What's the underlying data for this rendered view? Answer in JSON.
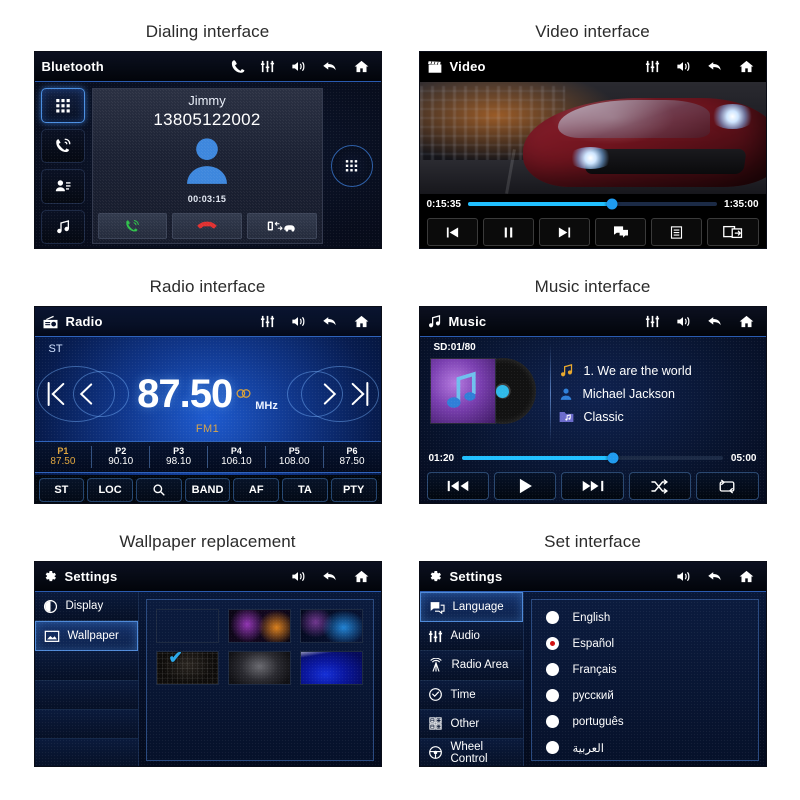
{
  "panels": [
    {
      "caption": "Dialing interface",
      "title": "Bluetooth",
      "statusIcons": [
        "phone-icon",
        "equalizer-icon",
        "volume-icon",
        "back-icon",
        "home-icon"
      ],
      "rail": [
        "keypad-icon",
        "call-log-icon",
        "contacts-icon",
        "music-icon"
      ],
      "contact_name": "Jimmy",
      "phone_number": "13805122002",
      "call_timer": "00:03:15",
      "actions": [
        "answer-call-icon",
        "end-call-icon",
        "transfer-audio-icon"
      ],
      "keypad_button": "dialpad-icon"
    },
    {
      "caption": "Video interface",
      "title": "Video",
      "titleIcon": "clapperboard-icon",
      "statusIcons": [
        "equalizer-icon",
        "volume-icon",
        "back-icon",
        "home-icon"
      ],
      "elapsed": "0:15:35",
      "duration": "1:35:00",
      "progress_percent": 58,
      "controls": [
        "previous-icon",
        "pause-icon",
        "next-icon",
        "subtitle-icon",
        "playlist-icon",
        "screen-share-icon"
      ]
    },
    {
      "caption": "Radio interface",
      "title": "Radio",
      "titleIcon": "radio-icon",
      "statusIcons": [
        "equalizer-icon",
        "volume-icon",
        "back-icon",
        "home-icon"
      ],
      "stereo_indicator": "ST",
      "frequency": "87.50",
      "unit": "MHz",
      "band": "FM1",
      "presets": [
        {
          "name": "P1",
          "freq": "87.50",
          "active": true
        },
        {
          "name": "P2",
          "freq": "90.10",
          "active": false
        },
        {
          "name": "P3",
          "freq": "98.10",
          "active": false
        },
        {
          "name": "P4",
          "freq": "106.10",
          "active": false
        },
        {
          "name": "P5",
          "freq": "108.00",
          "active": false
        },
        {
          "name": "P6",
          "freq": "87.50",
          "active": false
        }
      ],
      "tabs": [
        "ST",
        "LOC",
        "search-icon",
        "BAND",
        "AF",
        "TA",
        "PTY"
      ]
    },
    {
      "caption": "Music interface",
      "title": "Music",
      "titleIcon": "music-note-icon",
      "statusIcons": [
        "equalizer-icon",
        "volume-icon",
        "back-icon",
        "home-icon"
      ],
      "source_label": "SD:01/80",
      "track": "1.  We are the world",
      "artist": "Michael Jackson",
      "genre": "Classic",
      "elapsed": "01:20",
      "duration": "05:00",
      "progress_percent": 58,
      "controls": [
        "previous-track-icon",
        "play-icon",
        "next-track-icon",
        "shuffle-icon",
        "repeat-icon"
      ]
    },
    {
      "caption": "Wallpaper replacement",
      "title": "Settings",
      "titleIcon": "gear-icon",
      "statusIcons": [
        "volume-icon",
        "back-icon",
        "home-icon"
      ],
      "menu": [
        {
          "label": "Display",
          "icon": "contrast-icon",
          "active": false
        },
        {
          "label": "Wallpaper",
          "icon": "image-icon",
          "active": true
        },
        {
          "label": "",
          "icon": "",
          "active": false
        },
        {
          "label": "",
          "icon": "",
          "active": false
        },
        {
          "label": "",
          "icon": "",
          "active": false
        },
        {
          "label": "",
          "icon": "",
          "active": false
        }
      ],
      "wallpapers": [
        {
          "id": "wp-blue-glow",
          "selected": true
        },
        {
          "id": "wp-neon-waves",
          "selected": false
        },
        {
          "id": "wp-cyan-bloom",
          "selected": false
        },
        {
          "id": "wp-dark-mesh",
          "selected": false
        },
        {
          "id": "wp-grey-fog",
          "selected": false
        },
        {
          "id": "wp-blue-streak",
          "selected": false
        }
      ],
      "check_mark": "✔"
    },
    {
      "caption": "Set interface",
      "title": "Settings",
      "titleIcon": "gear-icon",
      "statusIcons": [
        "volume-icon",
        "back-icon",
        "home-icon"
      ],
      "menu": [
        {
          "label": "Language",
          "icon": "speech-bubble-icon",
          "active": true
        },
        {
          "label": "Audio",
          "icon": "equalizer-icon",
          "active": false
        },
        {
          "label": "Radio Area",
          "icon": "antenna-icon",
          "active": false
        },
        {
          "label": "Time",
          "icon": "clock-icon",
          "active": false
        },
        {
          "label": "Other",
          "icon": "apps-icon",
          "active": false
        },
        {
          "label": "Wheel Control",
          "icon": "steering-wheel-icon",
          "active": false
        }
      ],
      "languages": [
        {
          "label": "English",
          "selected": false
        },
        {
          "label": "Español",
          "selected": true
        },
        {
          "label": "Français",
          "selected": false
        },
        {
          "label": "русский",
          "selected": false
        },
        {
          "label": "português",
          "selected": false
        },
        {
          "label": "العربية",
          "selected": false
        }
      ]
    }
  ],
  "colors": {
    "accent_blue": "#21c0ff",
    "amber": "#e0a63f",
    "call_green": "#2fc04a",
    "end_red": "#e03030",
    "radio_red": "#d01010",
    "screen_bg": "#05070e"
  }
}
